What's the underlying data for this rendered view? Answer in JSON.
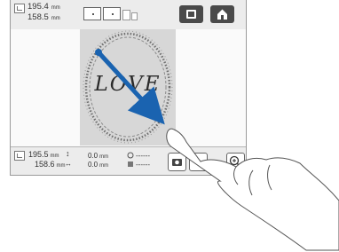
{
  "header": {
    "width_value": "195.4",
    "height_value": "158.5",
    "unit": "mm"
  },
  "design": {
    "text": "LOVE"
  },
  "footer": {
    "size_width": "195.5",
    "size_height": "158.6",
    "size_unit": "mm",
    "offset_vertical": "0.0",
    "offset_horizontal": "0.0",
    "offset_unit": "mm",
    "angle_placeholder": "------",
    "color_placeholder": "------"
  },
  "icons": {
    "size": "dimension-icon",
    "hoop": "hoop-size-icon",
    "thread_view": "thread-view-icon",
    "home": "home-icon",
    "camera": "camera-icon",
    "zoom": "zoom-in-icon",
    "drag_arrow": "drag-arrow-icon",
    "hand": "pointing-hand-icon"
  },
  "colors": {
    "arrow": "#1a63b0",
    "button_dark": "#4a4a4a",
    "design_bg": "#d7d7d7"
  }
}
